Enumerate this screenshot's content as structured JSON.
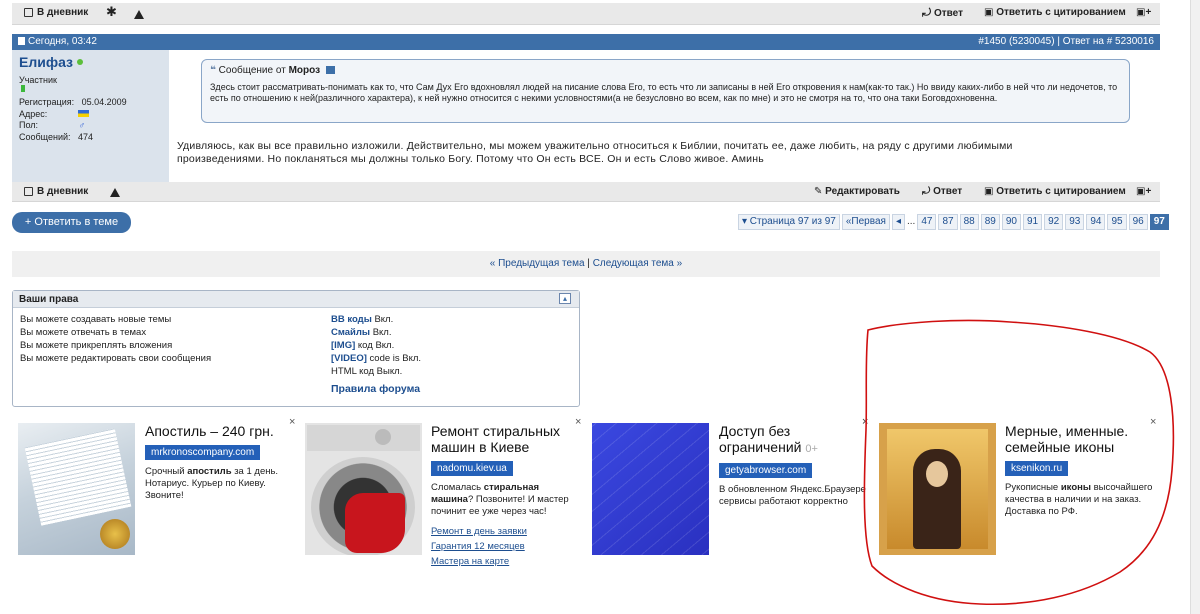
{
  "top_bar": {
    "diary_label": "В дневник",
    "reply_label": "Ответ",
    "reply_quote_label": "Ответить с цитированием"
  },
  "post": {
    "date": "Сегодня, 03:42",
    "post_ref": "#1450 (5230045) | Ответ на # 5230016",
    "author": "Елифаз",
    "role": "Участник",
    "registration_label": "Регистрация:",
    "registration_value": "05.04.2009",
    "address_label": "Адрес:",
    "gender_label": "Пол:",
    "messages_label": "Сообщений:",
    "messages_value": "474",
    "quote_prefix": "Сообщение от",
    "quote_author": "Мороз",
    "quote_text": "Здесь стоит рассматривать-понимать как то, что Сам Дух Его вдохновлял людей на писание слова Его, то есть что ли записаны в ней Его откровения к нам(как-то так.) Но ввиду каких-либо в ней что ли недочетов, то есть по отношению к ней(различного характера), к ней нужно относится с некими условностями(а не безусловно во всем, как по мне) и это не смотря на то, что она таки Боговдохновенна.",
    "body_text": "Удивляюсь, как вы все правильно изложили. Действительно, мы можем уважительно относиться к Библии, почитать ее, даже любить, на ряду с другими любимыми произведениями. Но покланяться мы должны только Богу. Потому что Он есть ВСЕ. Он и есть Слово живое. Аминь"
  },
  "bottom_bar": {
    "diary_label": "В дневник",
    "edit_label": "Редактировать",
    "reply_label": "Ответ",
    "reply_quote_label": "Ответить с цитированием"
  },
  "reply_button": "+ Ответить в теме",
  "pagination": {
    "page_info": "▾ Страница 97 из 97",
    "first": "«Первая",
    "prev": "◂",
    "ellipsis": "...",
    "pages": [
      "47",
      "87",
      "88",
      "89",
      "90",
      "91",
      "92",
      "93",
      "94",
      "95",
      "96"
    ],
    "current": "97"
  },
  "thread_nav": {
    "prev": "« Предыдущая тема",
    "separator": "|",
    "next": "Следующая тема »"
  },
  "rights": {
    "title": "Ваши права",
    "left": [
      "Вы можете создавать новые темы",
      "Вы можете отвечать в темах",
      "Вы можете прикреплять вложения",
      "Вы можете редактировать свои сообщения"
    ],
    "bb_codes": "BB коды",
    "bb_state": "Вкл.",
    "smiles": "Смайлы",
    "smiles_state": "Вкл.",
    "img": "[IMG]",
    "img_state": "код Вкл.",
    "video": "[VIDEO]",
    "video_state": "code is Вкл.",
    "html": "HTML код Выкл.",
    "rules": "Правила форума"
  },
  "ads": [
    {
      "title": "Апостиль – 240 грн.",
      "domain": "mrkronoscompany.com",
      "text_html_parts": [
        "Срочный ",
        "апостиль",
        " за 1 день. Нотариус. Курьер по Киеву. Звоните!"
      ],
      "links": []
    },
    {
      "title": "Ремонт стиральных машин в Киеве",
      "domain": "nadomu.kiev.ua",
      "text_html_parts": [
        "Сломалась ",
        "стиральная машина",
        "? Позвоните! И мастер починит ее уже через час!"
      ],
      "links": [
        "Ремонт в день заявки",
        "Гарантия 12 месяцев",
        "Мастера на карте"
      ]
    },
    {
      "title": "Доступ без ограничений",
      "age": "0+",
      "domain": "getyabrowser.com",
      "text_html_parts": [
        "В обновленном Яндекс.Браузере сервисы работают корректно",
        "",
        ""
      ],
      "links": []
    },
    {
      "title": "Мерные, именные. семейные иконы",
      "domain": "ksenikon.ru",
      "text_html_parts": [
        "Рукописные ",
        "иконы",
        " высочайшего качества в наличии и на заказ. Доставка по РФ."
      ],
      "links": []
    }
  ],
  "ad_close": "×",
  "colors": {
    "header_blue": "#3d6fa8",
    "side_panel": "#dbe3ec",
    "link_blue": "#1d4e8f",
    "ad_domain_blue": "#2460b8",
    "red_annotation": "#d01010"
  },
  "icons": [
    "diary-icon",
    "star-icon",
    "warning-icon",
    "reply-icon",
    "quote-reply-icon",
    "multiquote-icon",
    "edit-icon",
    "online-dot-icon",
    "collapse-icon"
  ]
}
